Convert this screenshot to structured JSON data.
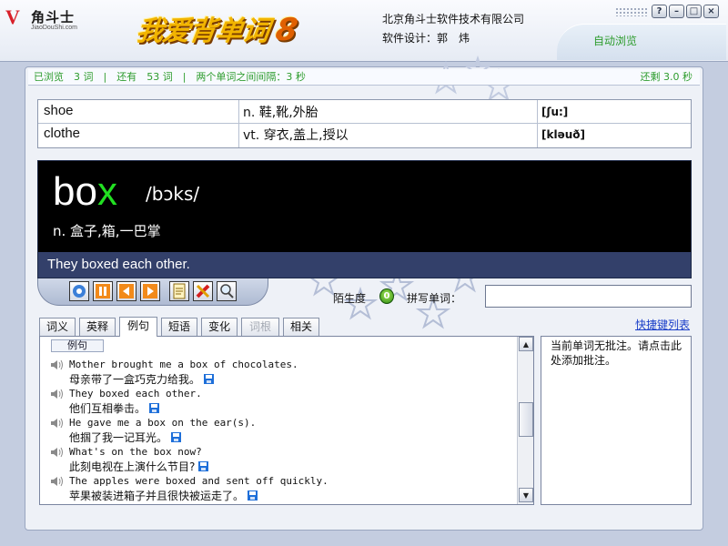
{
  "header": {
    "logo_cn": "角斗士",
    "logo_url": "JiaoDouShi.com",
    "app_title": "我爱背单词",
    "app_version": "8",
    "company": "北京角斗士软件技术有限公司",
    "designer": "软件设计：郭　炜",
    "auto_browse": "自动浏览",
    "window_buttons": [
      "?",
      "–",
      "□",
      "×"
    ]
  },
  "status": {
    "left": "已浏览　3 词　|　还有　53 词　|　两个单词之间间隔：3 秒",
    "right": "还剩 3.0 秒"
  },
  "word_table": [
    {
      "word": "shoe",
      "definition": "n.  鞋,靴,外胎",
      "phonetic": "[ʃu:]"
    },
    {
      "word": "clothe",
      "definition": "vt.  穿衣,盖上,授以",
      "phonetic": "[kləuð]"
    }
  ],
  "current": {
    "word_prefix": "bo",
    "word_highlight": "x",
    "phonetic": "/bɔks/",
    "definition": "n. 盒子,箱,一巴掌",
    "sentence": "They boxed each other."
  },
  "toolbar": {
    "icons": [
      "settings-icon",
      "pause-icon",
      "previous-icon",
      "next-icon",
      "notepad-icon",
      "edit-icon",
      "search-icon"
    ]
  },
  "familiarity": {
    "label": "陌生度",
    "value": "0"
  },
  "spell": {
    "label": "拼写单词：",
    "value": ""
  },
  "shortcut_link": "快捷键列表",
  "tabs": [
    {
      "label": "词义",
      "state": "normal"
    },
    {
      "label": "英释",
      "state": "normal"
    },
    {
      "label": "例句",
      "state": "active"
    },
    {
      "label": "短语",
      "state": "normal"
    },
    {
      "label": "变化",
      "state": "normal"
    },
    {
      "label": "词根",
      "state": "disabled"
    },
    {
      "label": "相关",
      "state": "normal"
    }
  ],
  "examples": {
    "header": "例句",
    "items": [
      {
        "en": "Mother brought me a box of chocolates.",
        "cn": "母亲带了一盒巧克力给我。"
      },
      {
        "en": "They boxed each other.",
        "cn": "他们互相拳击。"
      },
      {
        "en": "He gave me a box on the ear(s).",
        "cn": "他掴了我一记耳光。"
      },
      {
        "en": "What's on the box now?",
        "cn": "此刻电视在上演什么节目?"
      },
      {
        "en": "The apples were boxed and sent off quickly.",
        "cn": "苹果被装进箱子并且很快被运走了。"
      }
    ]
  },
  "note": {
    "text": "当前单词无批注。请点击此处添加批注。"
  },
  "colors": {
    "status_green": "#2d9c2d",
    "highlight_green": "#22e022",
    "sentence_bar": "#33406a",
    "link_blue": "#1a3ec8"
  }
}
